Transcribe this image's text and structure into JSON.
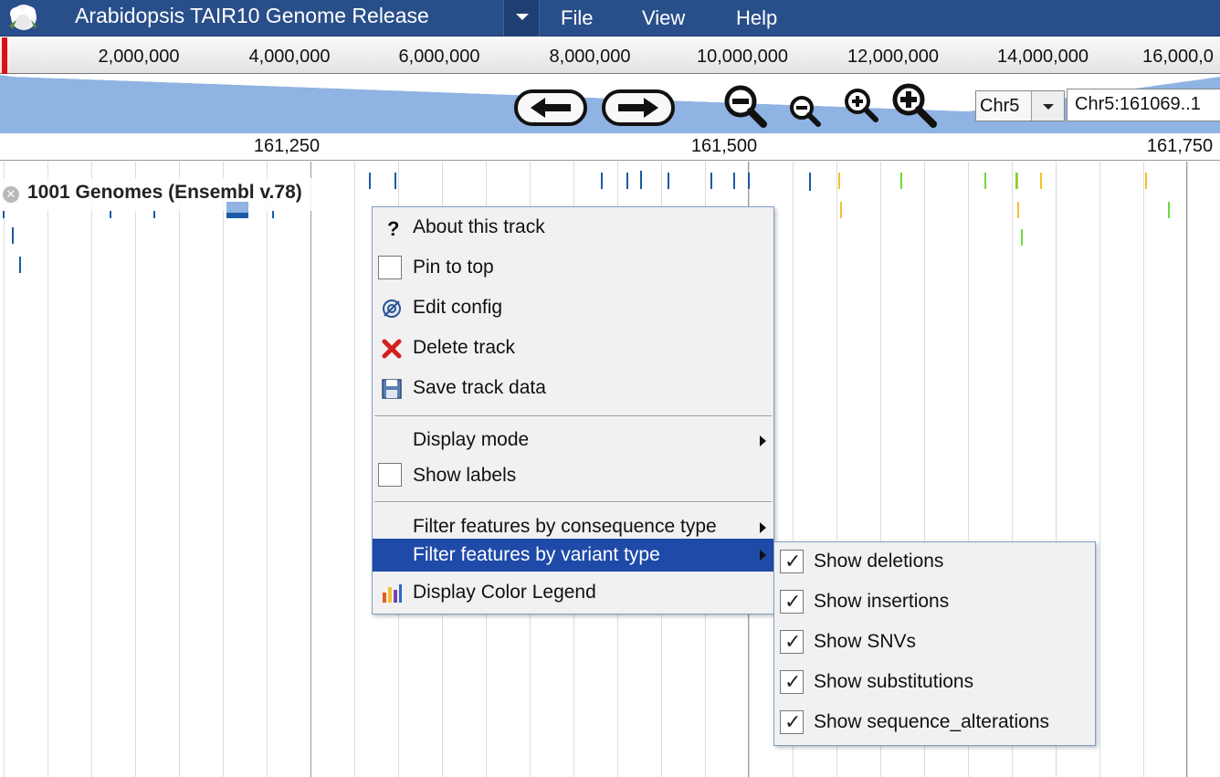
{
  "app": {
    "dataset_title": "Arabidopsis TAIR10 Genome Release",
    "menus": [
      "File",
      "View",
      "Help"
    ]
  },
  "overview": {
    "labels": [
      "2,000,000",
      "4,000,000",
      "6,000,000",
      "8,000,000",
      "10,000,000",
      "12,000,000",
      "14,000,000",
      "16,000,0"
    ]
  },
  "navigation": {
    "buttons": [
      "pan-left",
      "pan-right",
      "zoom-out-large",
      "zoom-out-small",
      "zoom-in-small",
      "zoom-in-large"
    ],
    "chromosome": "Chr5",
    "location": "Chr5:161069..1"
  },
  "detail_ruler": {
    "labels": [
      "161,250",
      "161,500",
      "161,750"
    ]
  },
  "track": {
    "name": "1001 Genomes (Ensembl v.78)"
  },
  "colors": {
    "menubar": "#294f8a",
    "feature_blue": "#1b5aa6",
    "feature_yellow": "#f2c12e",
    "feature_green": "#6ddb35",
    "menu_highlight": "#1f4aa8"
  },
  "context_menu": {
    "about": "About this track",
    "pin": "Pin to top",
    "edit": "Edit config",
    "delete": "Delete track",
    "save": "Save track data",
    "display_mode": "Display mode",
    "show_labels": "Show labels",
    "filter_consequence": "Filter features by consequence type",
    "filter_variant": "Filter features by variant type",
    "color_legend": "Display Color Legend"
  },
  "variant_submenu": {
    "items": [
      {
        "label": "Show deletions",
        "checked": true
      },
      {
        "label": "Show insertions",
        "checked": true
      },
      {
        "label": "Show SNVs",
        "checked": true
      },
      {
        "label": "Show substitutions",
        "checked": true
      },
      {
        "label": "Show sequence_alterations",
        "checked": true
      }
    ]
  }
}
